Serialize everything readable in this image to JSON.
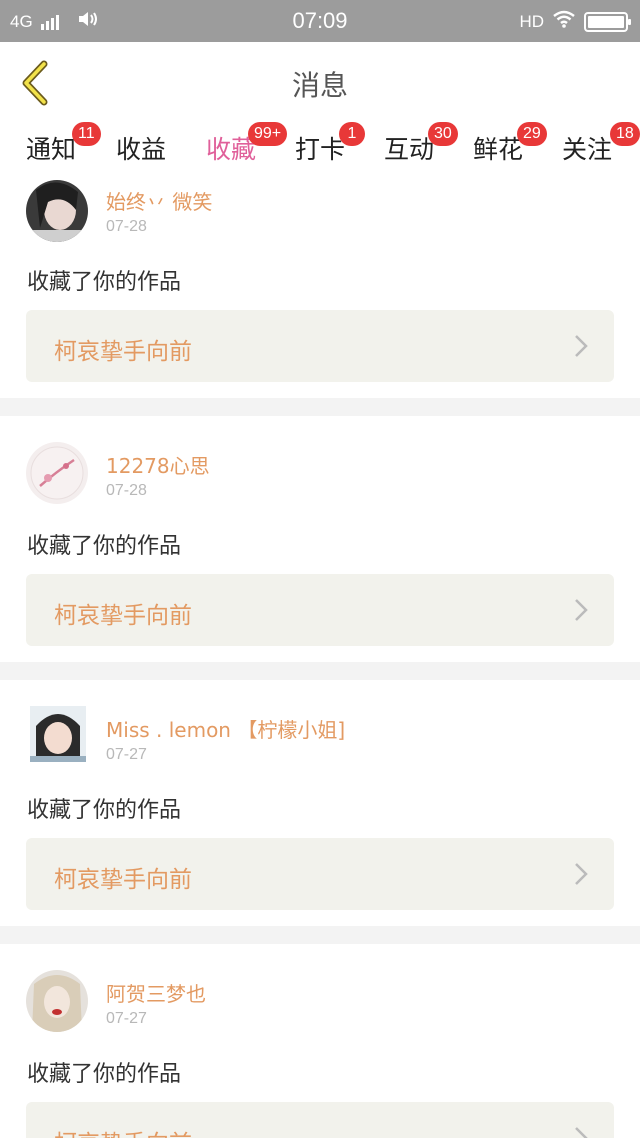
{
  "status_bar": {
    "network": "4G",
    "time": "07:09",
    "hd": "HD"
  },
  "header": {
    "title": "消息"
  },
  "tabs": [
    {
      "label": "通知",
      "badge": "11",
      "active": false
    },
    {
      "label": "收益",
      "badge": "",
      "active": false
    },
    {
      "label": "收藏",
      "badge": "99+",
      "active": true
    },
    {
      "label": "打卡",
      "badge": "1",
      "active": false
    },
    {
      "label": "互动",
      "badge": "30",
      "active": false
    },
    {
      "label": "鲜花",
      "badge": "29",
      "active": false
    },
    {
      "label": "关注",
      "badge": "18",
      "active": false
    }
  ],
  "feed": [
    {
      "username": "始终丷 微笑",
      "date": "07-28",
      "action": "收藏了你的作品",
      "work_title": "柯哀挚手向前"
    },
    {
      "username": "12278心思",
      "date": "07-28",
      "action": "收藏了你的作品",
      "work_title": "柯哀挚手向前"
    },
    {
      "username": "Miss . lemon 【柠檬小姐]",
      "date": "07-27",
      "action": "收藏了你的作品",
      "work_title": "柯哀挚手向前"
    },
    {
      "username": "阿贺三梦也",
      "date": "07-27",
      "action": "收藏了你的作品",
      "work_title": "柯哀挚手向前"
    }
  ],
  "colors": {
    "accent_pink": "#e0609a",
    "username_orange": "#e39a62",
    "badge_red": "#e83838",
    "status_bar_gray": "#9c9c9c"
  },
  "icons": [
    "back-arrow-icon",
    "chevron-right-icon",
    "wifi-icon",
    "battery-icon",
    "signal-icon",
    "volume-icon"
  ]
}
